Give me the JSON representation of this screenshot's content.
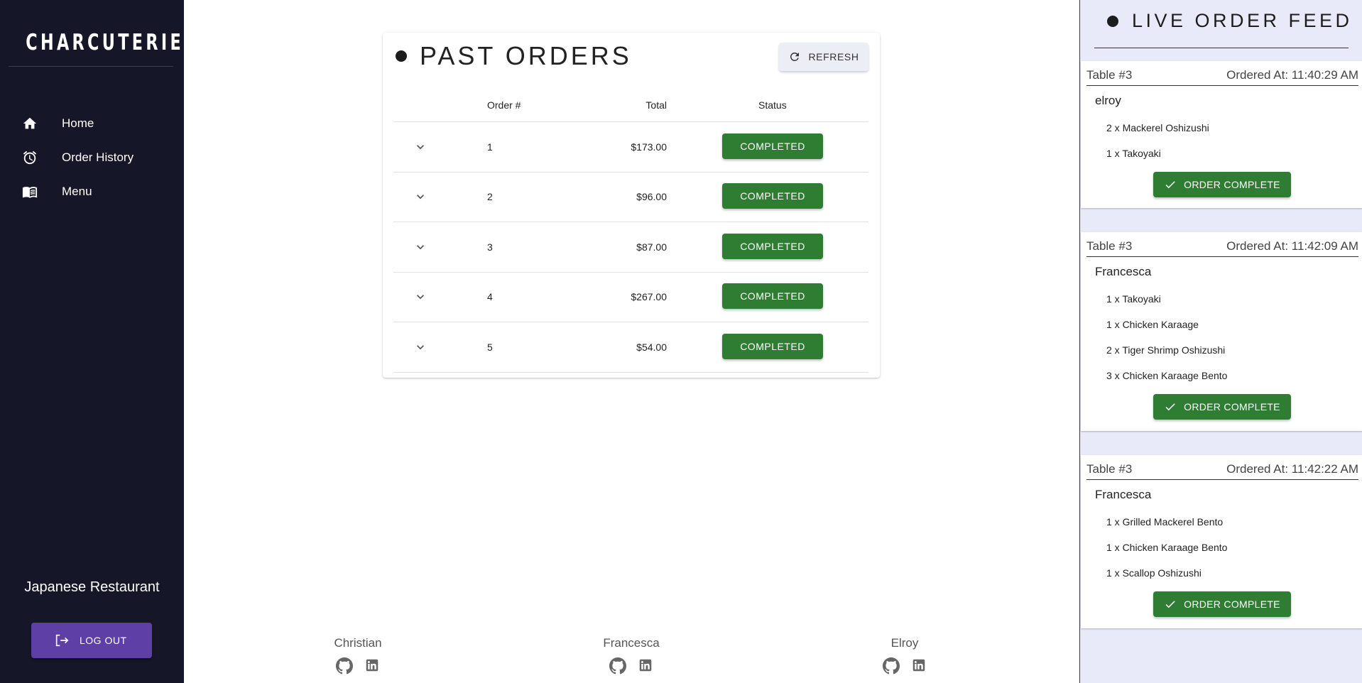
{
  "sidebar": {
    "brand": "CHARCUTERIE",
    "items": [
      {
        "label": "Home",
        "icon": "home-icon"
      },
      {
        "label": "Order History",
        "icon": "alarm-clock-icon"
      },
      {
        "label": "Menu",
        "icon": "menu-book-icon"
      }
    ],
    "restaurant_name": "Japanese Restaurant",
    "logout_label": "LOG OUT"
  },
  "past_orders": {
    "title": "PAST ORDERS",
    "refresh_label": "REFRESH",
    "columns": {
      "order": "Order #",
      "total": "Total",
      "status": "Status"
    },
    "rows": [
      {
        "order": "1",
        "total": "$173.00",
        "status": "COMPLETED"
      },
      {
        "order": "2",
        "total": "$96.00",
        "status": "COMPLETED"
      },
      {
        "order": "3",
        "total": "$87.00",
        "status": "COMPLETED"
      },
      {
        "order": "4",
        "total": "$267.00",
        "status": "COMPLETED"
      },
      {
        "order": "5",
        "total": "$54.00",
        "status": "COMPLETED"
      }
    ]
  },
  "footer": {
    "people": [
      {
        "name": "Christian"
      },
      {
        "name": "Francesca"
      },
      {
        "name": "Elroy"
      }
    ]
  },
  "live_feed": {
    "title": "LIVE ORDER FEED",
    "button_label": "ORDER COMPLETE",
    "orders": [
      {
        "table": "Table #3",
        "ordered_at": "Ordered At: 11:40:29 AM",
        "customer": "elroy",
        "items": [
          "2 x Mackerel Oshizushi",
          "1 x Takoyaki"
        ]
      },
      {
        "table": "Table #3",
        "ordered_at": "Ordered At: 11:42:09 AM",
        "customer": "Francesca",
        "items": [
          "1 x Takoyaki",
          "1 x Chicken Karaage",
          "2 x Tiger Shrimp Oshizushi",
          "3 x Chicken Karaage Bento"
        ]
      },
      {
        "table": "Table #3",
        "ordered_at": "Ordered At: 11:42:22 AM",
        "customer": "Francesca",
        "items": [
          "1 x Grilled Mackerel Bento",
          "1 x Chicken Karaage Bento",
          "1 x Scallop Oshizushi"
        ]
      }
    ]
  },
  "colors": {
    "sidebar_bg": "#151728",
    "logout_bg": "#5d3fa6",
    "status_green": "#2e7d32",
    "feed_bg": "#e8eafa"
  }
}
